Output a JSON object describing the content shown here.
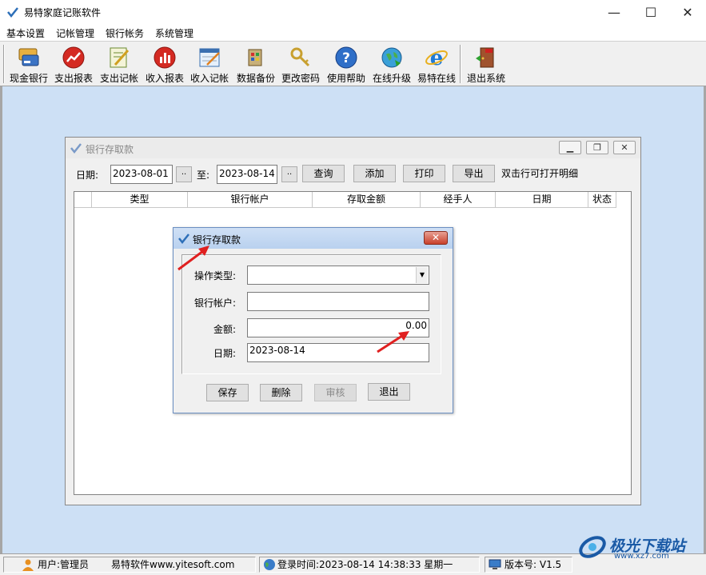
{
  "app": {
    "title": "易特家庭记账软件",
    "window_controls": {
      "minimize": "—",
      "maximize": "☐",
      "close": "✕"
    }
  },
  "menu": [
    "基本设置",
    "记帐管理",
    "银行帐务",
    "系统管理"
  ],
  "toolbar": [
    {
      "label": "现金银行",
      "icon": "cash-bank-icon"
    },
    {
      "label": "支出报表",
      "icon": "expense-report-icon"
    },
    {
      "label": "支出记帐",
      "icon": "expense-entry-icon"
    },
    {
      "label": "收入报表",
      "icon": "income-report-icon"
    },
    {
      "label": "收入记帐",
      "icon": "income-entry-icon"
    },
    {
      "label": "数据备份",
      "icon": "data-backup-icon"
    },
    {
      "label": "更改密码",
      "icon": "change-password-icon"
    },
    {
      "label": "使用帮助",
      "icon": "help-icon"
    },
    {
      "label": "在线升级",
      "icon": "online-upgrade-icon"
    },
    {
      "label": "易特在线",
      "icon": "ie-browser-icon"
    },
    {
      "label": "退出系统",
      "icon": "exit-door-icon"
    }
  ],
  "child_window": {
    "title": "银行存取款",
    "date_label": "日期:",
    "date_from": "2023-08-01",
    "to_label": "至:",
    "date_to": "2023-08-14",
    "picker_label": "..",
    "buttons": {
      "query": "查询",
      "add": "添加",
      "print": "打印",
      "export": "导出"
    },
    "hint": "双击行可打开明细",
    "columns": [
      "类型",
      "银行帐户",
      "存取金额",
      "经手人",
      "日期",
      "状态"
    ]
  },
  "dialog": {
    "title": "银行存取款",
    "close": "✕",
    "fields": {
      "op_type_label": "操作类型:",
      "op_type_value": "",
      "account_label": "银行帐户:",
      "account_value": "",
      "amount_label": "金额:",
      "amount_value": "0.00",
      "date_label": "日期:",
      "date_value": "2023-08-14"
    },
    "buttons": {
      "save": "保存",
      "delete": "删除",
      "audit": "审核",
      "exit": "退出"
    }
  },
  "statusbar": {
    "user": "用户:管理员",
    "company": "易特软件www.yitesoft.com",
    "login": "登录时间:2023-08-14 14:38:33 星期一",
    "version": "版本号: V1.5"
  },
  "watermark": {
    "text": "极光下载站",
    "url": "www.xz7.com"
  }
}
